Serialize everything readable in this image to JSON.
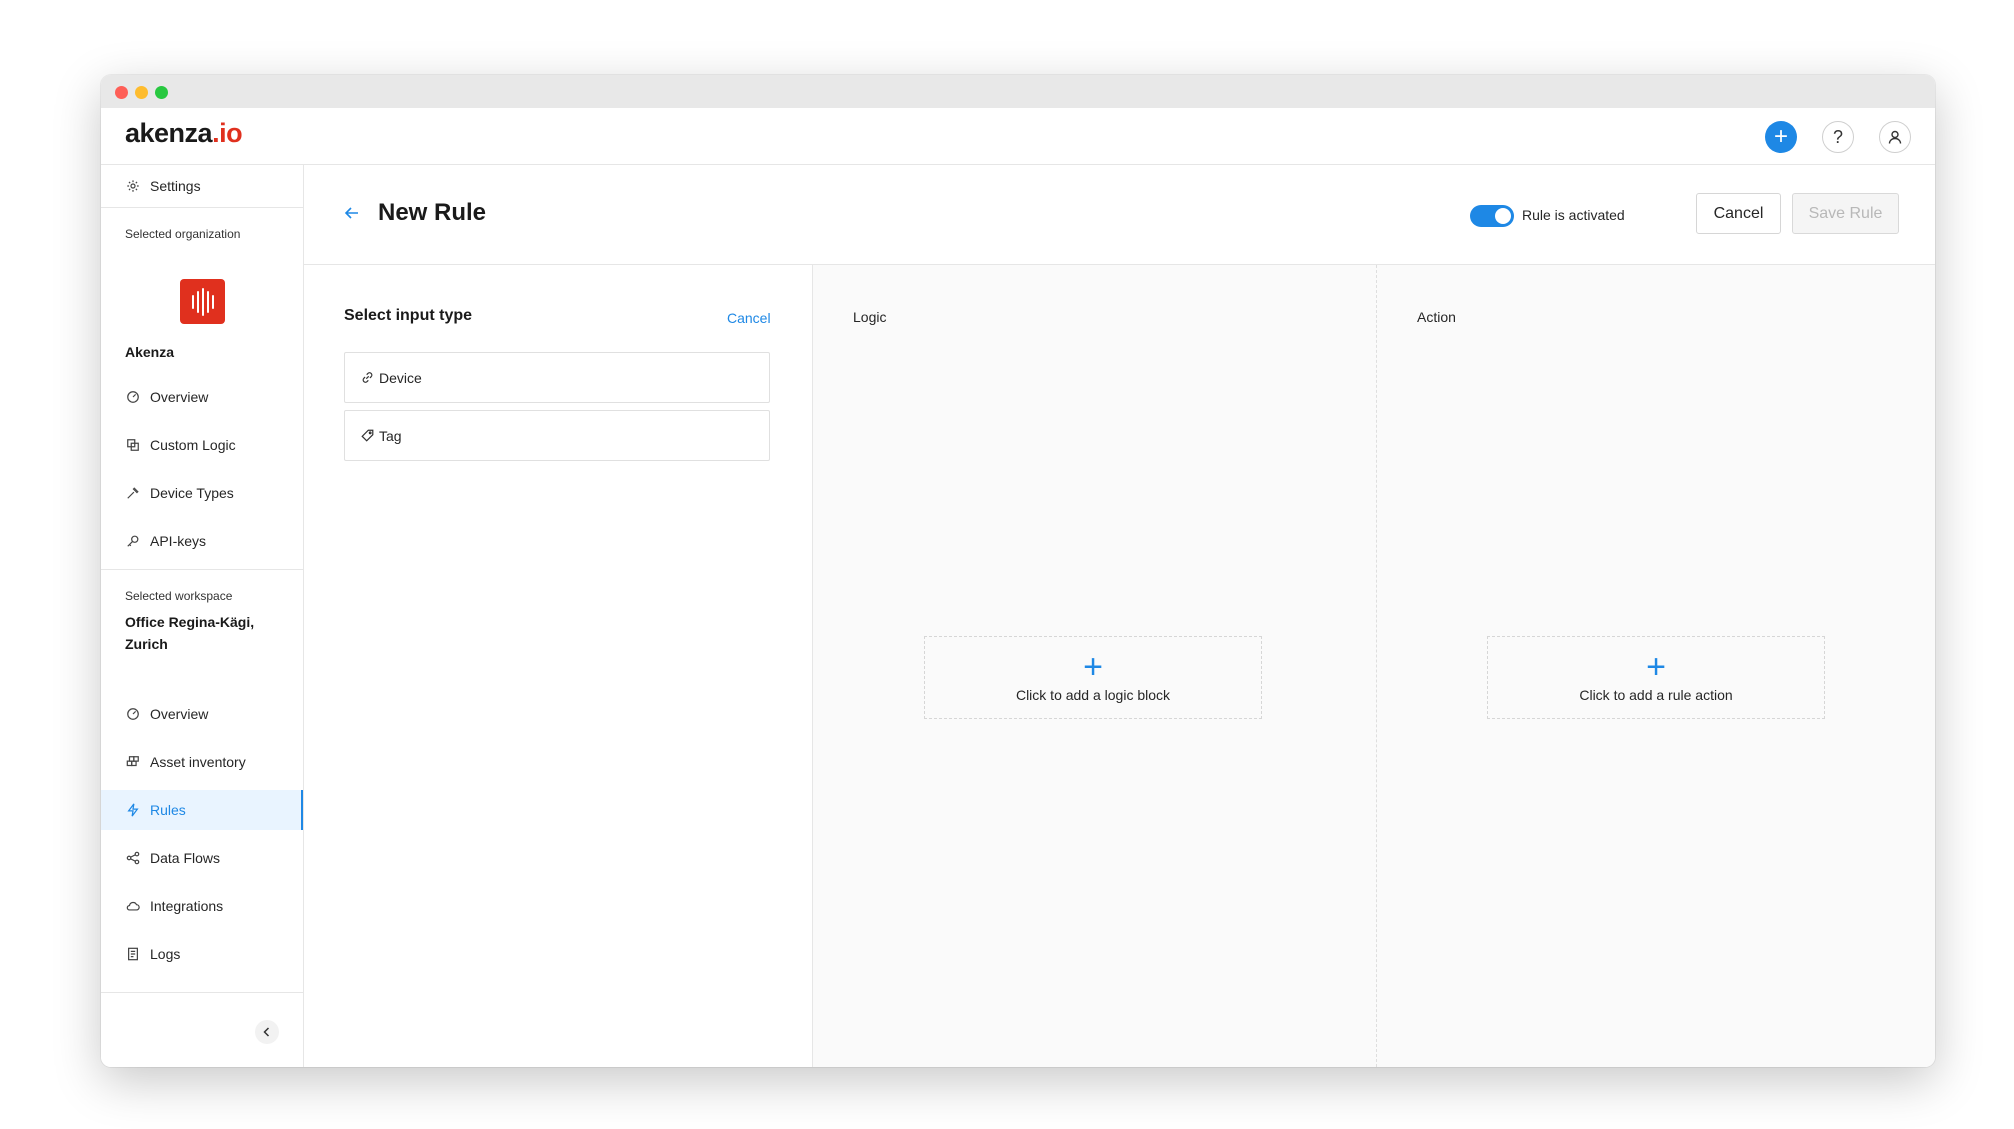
{
  "app": {
    "logo_main": "akenza",
    "logo_suffix": ".io"
  },
  "topbar": {
    "add_glyph": "+",
    "help_glyph": "?",
    "icons": [
      "plus-icon",
      "help-icon",
      "user-icon"
    ]
  },
  "sidebar": {
    "settings_label": "Settings",
    "org_caption": "Selected organization",
    "org_name": "Akenza",
    "org_items": [
      {
        "label": "Overview",
        "icon": "dashboard-icon"
      },
      {
        "label": "Custom Logic",
        "icon": "copy-icon"
      },
      {
        "label": "Device Types",
        "icon": "hammer-icon"
      },
      {
        "label": "API-keys",
        "icon": "key-icon"
      }
    ],
    "workspace_caption": "Selected workspace",
    "workspace_name": "Office Regina-Kägi, Zurich",
    "workspace_items": [
      {
        "label": "Overview",
        "icon": "dashboard-icon"
      },
      {
        "label": "Asset inventory",
        "icon": "cubes-icon"
      },
      {
        "label": "Rules",
        "icon": "bolt-icon",
        "active": true
      },
      {
        "label": "Data Flows",
        "icon": "share-icon"
      },
      {
        "label": "Integrations",
        "icon": "cloud-icon"
      },
      {
        "label": "Logs",
        "icon": "log-icon"
      }
    ]
  },
  "header": {
    "title": "New Rule",
    "toggle_label": "Rule is activated",
    "toggle_on": true,
    "cancel_label": "Cancel",
    "save_label": "Save Rule"
  },
  "input_panel": {
    "title": "Select input type",
    "cancel_label": "Cancel",
    "options": [
      {
        "label": "Device",
        "icon": "link-icon"
      },
      {
        "label": "Tag",
        "icon": "tag-icon"
      }
    ]
  },
  "logic_panel": {
    "label": "Logic",
    "add_glyph": "+",
    "add_text": "Click to add a logic block"
  },
  "action_panel": {
    "label": "Action",
    "add_glyph": "+",
    "add_text": "Click to add a rule action"
  },
  "colors": {
    "accent": "#1e88e5",
    "brand_red": "#e0301e",
    "active_bg": "#e9f4ff"
  }
}
